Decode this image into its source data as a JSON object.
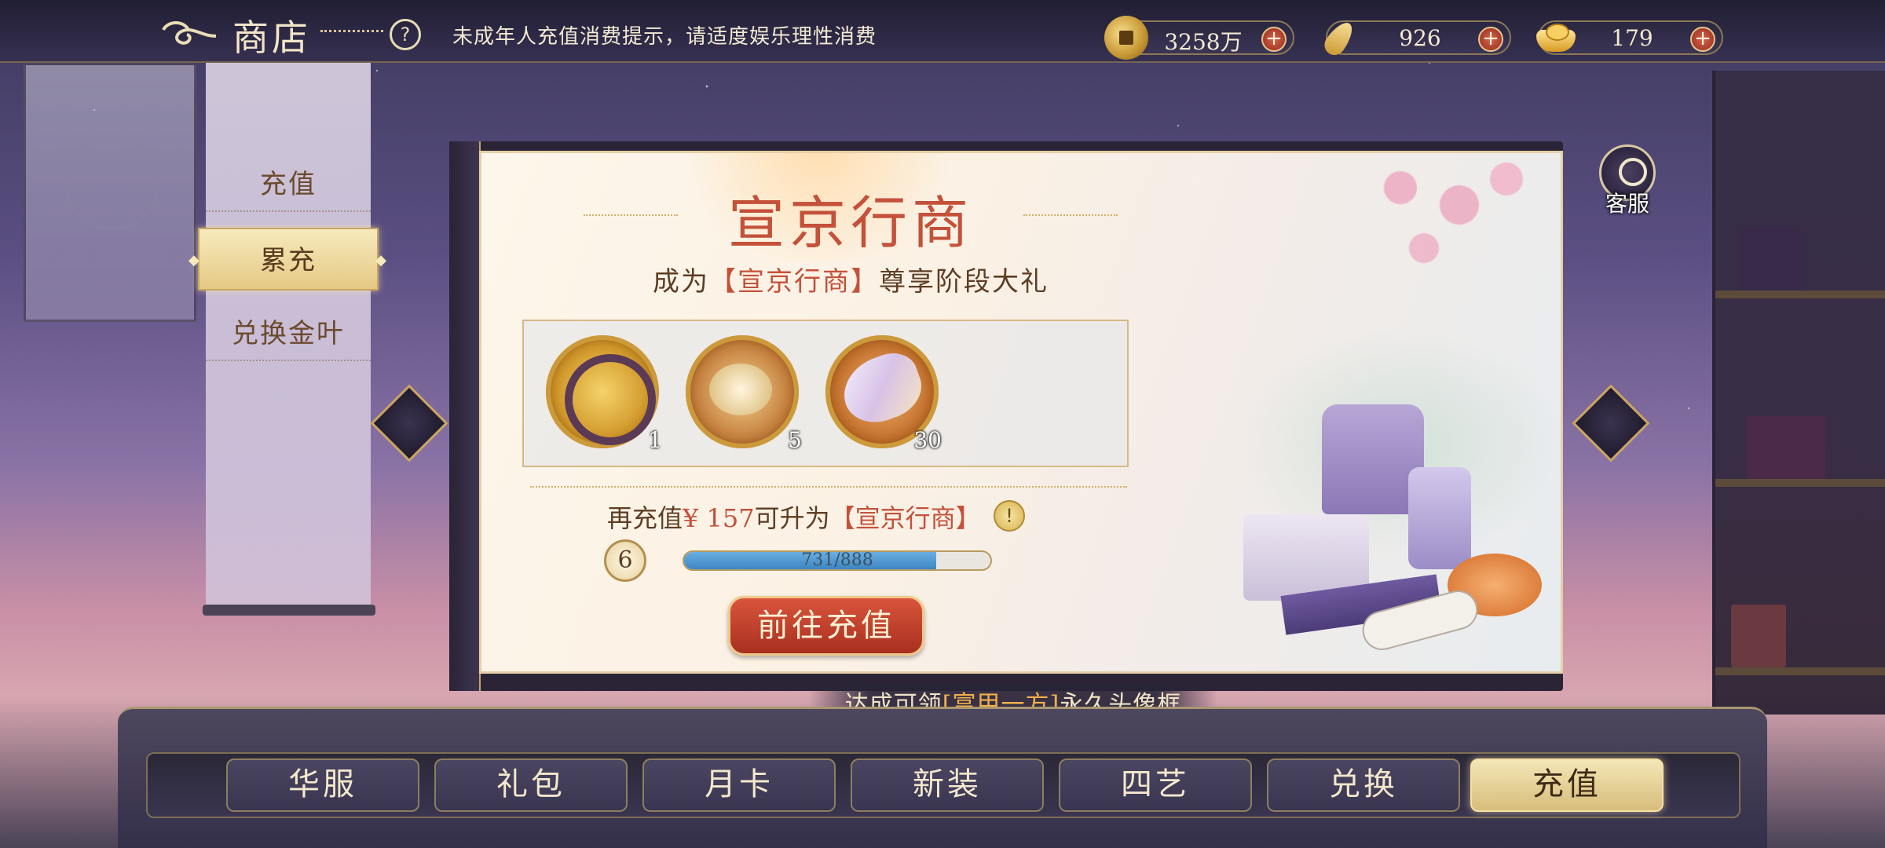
{
  "topbar": {
    "title": "商店",
    "notice": "未成年人充值消费提示，请适度娱乐理性消费",
    "currencies": [
      {
        "name": "coin",
        "icon": "coin-icon",
        "value": "3258万",
        "add": "+"
      },
      {
        "name": "gold-leaf",
        "icon": "leaf-icon",
        "value": "926",
        "add": "+"
      },
      {
        "name": "ingot",
        "icon": "ingot-icon",
        "value": "179",
        "add": "+"
      }
    ],
    "help": "?"
  },
  "side_menu": {
    "items": [
      {
        "label": "充值",
        "active": false
      },
      {
        "label": "累充",
        "active": true
      },
      {
        "label": "兑换金叶",
        "active": false
      }
    ]
  },
  "panel": {
    "title": "宣京行商",
    "subtitle_pre": "成为",
    "subtitle_rank": "【宣京行商】",
    "subtitle_post": "尊享阶段大礼",
    "rewards": [
      {
        "name": "avatar-frame",
        "count": "1"
      },
      {
        "name": "golden-pendant",
        "count": "5"
      },
      {
        "name": "crystal-petal",
        "count": "30"
      }
    ],
    "recharge_pre": "再充值",
    "recharge_amount": "¥ 157",
    "recharge_mid": "可升为",
    "recharge_rank": "【宣京行商】",
    "info": "!",
    "level": "6",
    "progress_text": "731/888",
    "progress_fraction": 0.823,
    "go_button": "前往充值"
  },
  "customer_service": {
    "label": "客服"
  },
  "award_banner": {
    "pre": "达成可领",
    "highlight": "[富甲一方]",
    "post": "永久头像框"
  },
  "tabs": [
    {
      "label": "华服",
      "active": false
    },
    {
      "label": "礼包",
      "active": false
    },
    {
      "label": "月卡",
      "active": false
    },
    {
      "label": "新装",
      "active": false
    },
    {
      "label": "四艺",
      "active": false
    },
    {
      "label": "兑换",
      "active": false
    },
    {
      "label": "充值",
      "active": true
    }
  ],
  "colors": {
    "accent_red": "#c4513a",
    "gold": "#d7bd7c",
    "progress_blue": "#3c86c4"
  }
}
